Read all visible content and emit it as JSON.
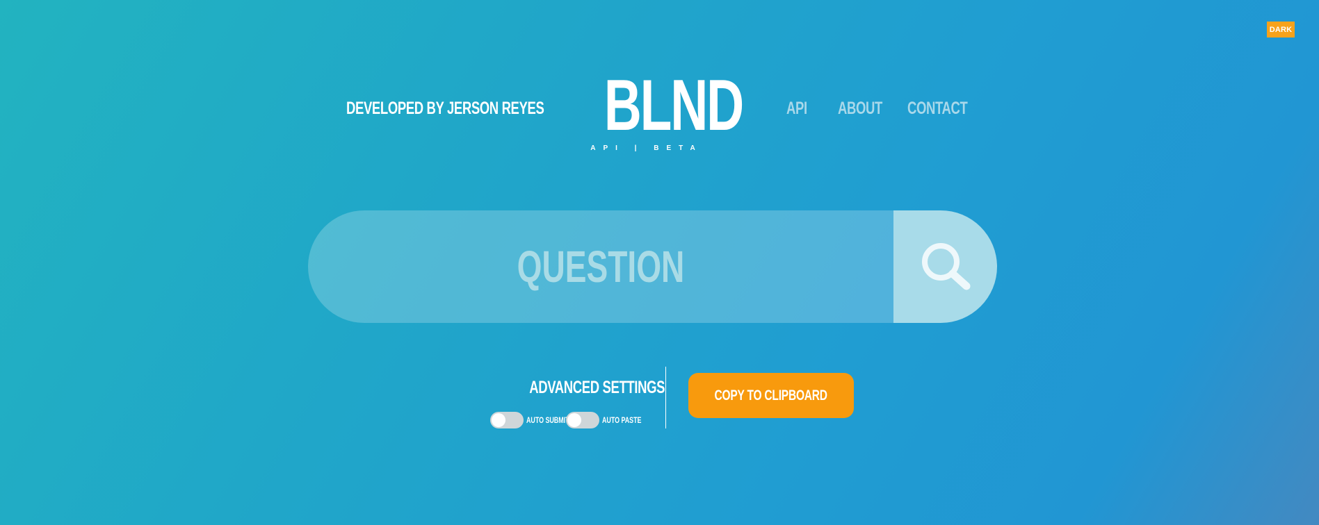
{
  "theme_toggle": {
    "label": "DARK"
  },
  "header": {
    "developer_credit": "DEVELOPED BY JERSON REYES",
    "logo": "BLND",
    "logo_subtitle": "API | BETA",
    "nav": [
      {
        "label": "API"
      },
      {
        "label": "ABOUT"
      },
      {
        "label": "CONTACT"
      }
    ]
  },
  "search": {
    "placeholder": "QUESTION",
    "value": "",
    "button_icon": "search-icon"
  },
  "settings": {
    "title": "ADVANCED SETTINGS",
    "toggles": [
      {
        "label": "AUTO SUBMIT",
        "checked": false
      },
      {
        "label": "AUTO PASTE",
        "checked": false
      }
    ]
  },
  "actions": {
    "copy_label": "COPY TO CLIPBOARD"
  },
  "colors": {
    "gradient_start": "#22b3c0",
    "gradient_end": "#4389c1",
    "accent_orange": "#f89a0d",
    "nav_text": "#a9d8ea"
  }
}
